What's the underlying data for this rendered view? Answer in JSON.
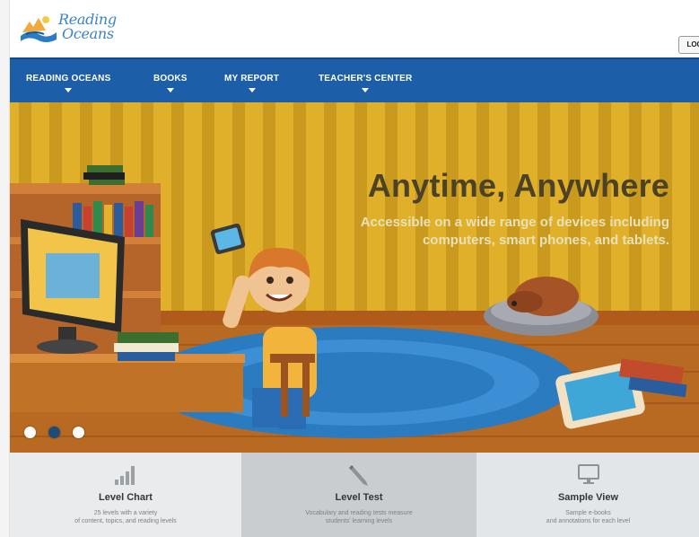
{
  "brand": {
    "logo_line1": "Reading",
    "logo_line2": "Oceans"
  },
  "header": {
    "login_label": "LOGI"
  },
  "nav": {
    "items": [
      {
        "label": "READING OCEANS"
      },
      {
        "label": "BOOKS"
      },
      {
        "label": "MY REPORT"
      },
      {
        "label": "TEACHER'S CENTER"
      }
    ]
  },
  "hero": {
    "title": "Anytime, Anywhere",
    "subtitle_line1": "Accessible on a wide range of devices including",
    "subtitle_line2": "computers, smart phones, and tablets.",
    "active_slide": 2,
    "slide_count": 3
  },
  "features": [
    {
      "title": "Level Chart",
      "desc_line1": "25 levels with a variety",
      "desc_line2": "of content, topics, and reading levels",
      "icon": "bar-chart-icon"
    },
    {
      "title": "Level Test",
      "desc_line1": "Vocabulary and reading tests measure",
      "desc_line2": "students' learning levels",
      "icon": "pencil-icon"
    },
    {
      "title": "Sample View",
      "desc_line1": "Sample e-books",
      "desc_line2": "and annotations for each level",
      "icon": "monitor-icon"
    }
  ],
  "colors": {
    "nav": "#1d5ea8",
    "hero_wall": "#e4b52a",
    "rug": "#2f83c8",
    "accent_dot": "#1e4c78"
  }
}
